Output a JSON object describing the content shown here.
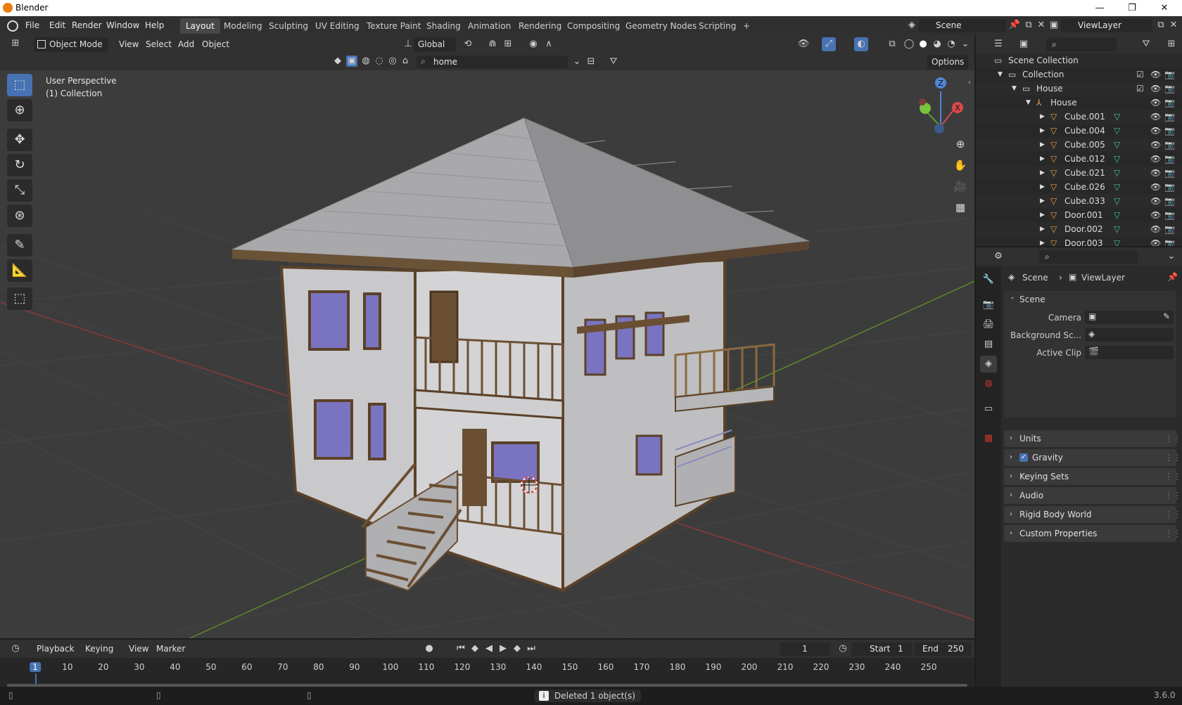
{
  "window": {
    "title": "Blender",
    "minimize": "—",
    "maximize": "❐",
    "close": "✕"
  },
  "menu": [
    "File",
    "Edit",
    "Render",
    "Window",
    "Help"
  ],
  "workspaces": [
    "Layout",
    "Modeling",
    "Sculpting",
    "UV Editing",
    "Texture Paint",
    "Shading",
    "Animation",
    "Rendering",
    "Compositing",
    "Geometry Nodes",
    "Scripting"
  ],
  "workspaces_add": "+",
  "scene": {
    "name": "Scene",
    "view_layer": "ViewLayer"
  },
  "viewport": {
    "mode": "Object Mode",
    "menu": [
      "View",
      "Select",
      "Add",
      "Object"
    ],
    "transform_orientation": "Global",
    "search_value": "home",
    "options_label": "Options",
    "overlay_line1": "User Perspective",
    "overlay_line2": "(1) Collection",
    "gizmo": {
      "z": "Z",
      "x": "X"
    }
  },
  "outliner": {
    "root": "Scene Collection",
    "collection": "Collection",
    "house_collection": "House",
    "house_empty": "House",
    "objects": [
      "Cube.001",
      "Cube.004",
      "Cube.005",
      "Cube.012",
      "Cube.021",
      "Cube.026",
      "Cube.033",
      "Door.001",
      "Door.002",
      "Door.003"
    ]
  },
  "properties": {
    "breadcrumb_scene": "Scene",
    "breadcrumb_sep": "›",
    "breadcrumb_layer": "ViewLayer",
    "panel_title": "Scene",
    "camera_label": "Camera",
    "background_label": "Background Sc...",
    "active_clip_label": "Active Clip",
    "sections": [
      "Units",
      "Gravity",
      "Keying Sets",
      "Audio",
      "Rigid Body World",
      "Custom Properties"
    ],
    "gravity_checked": true
  },
  "timeline": {
    "menu": [
      "Playback",
      "Keying",
      "View",
      "Marker"
    ],
    "current_frame": "1",
    "start_label": "Start",
    "start_value": "1",
    "end_label": "End",
    "end_value": "250",
    "ticks": [
      "1",
      "10",
      "20",
      "30",
      "40",
      "50",
      "60",
      "70",
      "80",
      "90",
      "100",
      "110",
      "120",
      "130",
      "140",
      "150",
      "160",
      "170",
      "180",
      "190",
      "200",
      "210",
      "220",
      "230",
      "240",
      "250"
    ]
  },
  "status": {
    "message": "Deleted 1 object(s)",
    "version": "3.6.0"
  },
  "colors": {
    "accent": "#4772b3",
    "header": "#303030",
    "viewport": "#3c3c3c",
    "x_axis": "#a63a3a",
    "y_axis": "#6b9a2e"
  }
}
